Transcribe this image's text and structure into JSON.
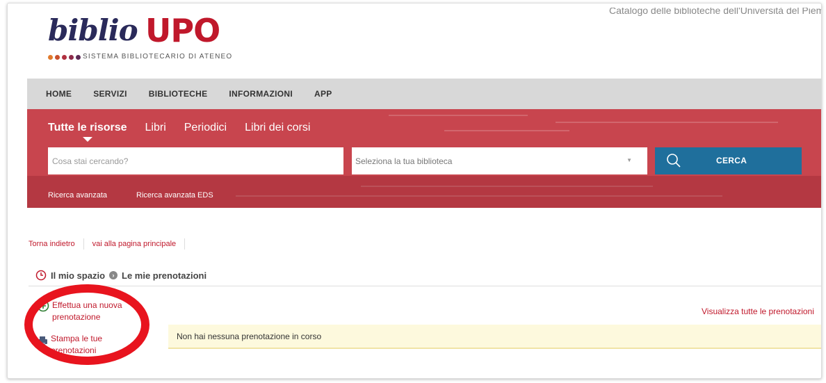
{
  "header": {
    "logo_word": "biblio",
    "logo_brand": "UPO",
    "logo_subtitle": "SISTEMA BIBLIOTECARIO DI ATENEO",
    "top_right_text": "Catalogo delle biblioteche dell'Università del Piemonte Orientale"
  },
  "nav": {
    "items": [
      "HOME",
      "SERVIZI",
      "BIBLIOTECHE",
      "INFORMAZIONI",
      "APP"
    ]
  },
  "search": {
    "tabs": [
      "Tutte le risorse",
      "Libri",
      "Periodici",
      "Libri dei corsi"
    ],
    "placeholder": "Cosa stai cercando?",
    "library_select": "Seleziona la tua biblioteca",
    "button_label": "CERCA",
    "advanced": "Ricerca avanzata",
    "advanced_eds": "Ricerca avanzata EDS"
  },
  "breadcrumb": {
    "back": "Torna indietro",
    "home": "vai alla pagina principale"
  },
  "section": {
    "title_prefix": "Il mio spazio",
    "title": "Le mie prenotazioni"
  },
  "actions": {
    "new_booking_line1": "Effettua una nuova",
    "new_booking_line2": "prenotazione",
    "print_line1": "Stampa le tue",
    "print_line2": "prenotazioni",
    "view_all": "Visualizza tutte le prenotazioni"
  },
  "notice": "Non hai nessuna prenotazione in corso",
  "colors": {
    "brand_red": "#c0182b",
    "hero_red": "#c8454e",
    "search_button": "#1f6f9c",
    "notice_bg": "#fdf9dd",
    "annotation_circle": "#e8141e"
  },
  "icons": {
    "clock": "clock-icon",
    "add": "plus-circle-icon",
    "print": "printer-icon",
    "search": "search-icon"
  }
}
